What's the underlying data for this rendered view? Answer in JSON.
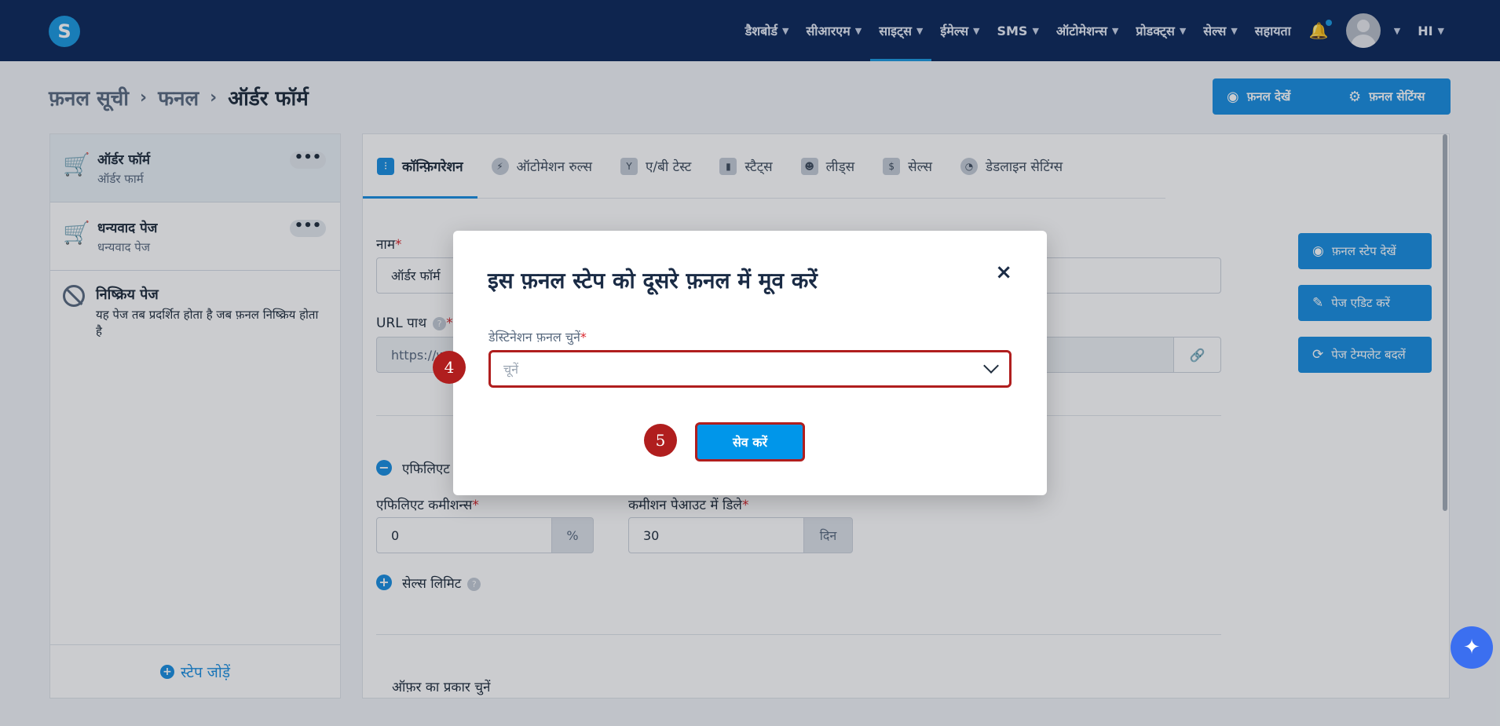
{
  "nav": {
    "logo": "S",
    "items": [
      {
        "label": "डैशबोर्ड"
      },
      {
        "label": "सीआरएम"
      },
      {
        "label": "साइट्स"
      },
      {
        "label": "ईमेल्स"
      },
      {
        "label": "SMS"
      },
      {
        "label": "ऑटोमेशन्स"
      },
      {
        "label": "प्रोडक्ट्स"
      },
      {
        "label": "सेल्स"
      }
    ],
    "active_index": 2,
    "help": "सहायता",
    "lang": "HI"
  },
  "breadcrumb": {
    "items": [
      "फ़नल सूची",
      "फनल",
      "ऑर्डर फॉर्म"
    ]
  },
  "header_buttons": {
    "view_funnel": "फ़नल देखें",
    "funnel_settings": "फ़नल सेटिंग्स"
  },
  "sidebar": {
    "steps": [
      {
        "title": "ऑर्डर फॉर्म",
        "subtitle": "ऑर्डर फार्म"
      },
      {
        "title": "धन्यवाद पेज",
        "subtitle": "धन्यवाद पेज"
      }
    ],
    "more": "•••",
    "inactive": {
      "title": "निष्क्रिय पेज",
      "desc": "यह पेज तब प्रदर्शित होता है जब फ़नल निष्क्रिय होता है"
    },
    "add_step": "स्टेप जोड़ें"
  },
  "tabs": [
    {
      "label": "कॉन्फ़िगरेशन",
      "icon": "sliders-icon",
      "glyph": "⫶"
    },
    {
      "label": "ऑटोमेशन रुल्स",
      "icon": "bolt-icon",
      "glyph": "⚡"
    },
    {
      "label": "ए/बी टेस्ट",
      "icon": "split-icon",
      "glyph": "Y"
    },
    {
      "label": "स्टैट्स",
      "icon": "stats-icon",
      "glyph": "▮"
    },
    {
      "label": "लीड्स",
      "icon": "users-icon",
      "glyph": "☻"
    },
    {
      "label": "सेल्स",
      "icon": "dollar-icon",
      "glyph": "$"
    },
    {
      "label": "डेडलाइन सेटिंग्स",
      "icon": "clock-icon",
      "glyph": "◔"
    }
  ],
  "form": {
    "name_label": "नाम",
    "name_value": "ऑर्डर फॉर्म",
    "url_label": "URL पाथ",
    "url_value": "https://w",
    "affiliate_section": "एफिलिएट",
    "affiliate_commission_label": "एफिलिएट कमीशन्स",
    "affiliate_commission_value": "0",
    "percent": "%",
    "payout_delay_label": "कमीशन पेआउट में डिले",
    "payout_delay_value": "30",
    "days": "दिन",
    "sales_limit": "सेल्स लिमिट",
    "offer_type": "ऑफ़र का प्रकार चुनें",
    "help_mark": "?"
  },
  "side_buttons": {
    "view_step": "फ़नल स्टेप देखें",
    "edit_page": "पेज एडिट करें",
    "change_template": "पेज टेम्पलेट बदलें"
  },
  "modal": {
    "title": "इस फ़नल स्टेप को दूसरे फ़नल में मूव करें",
    "close": "×",
    "dest_label": "डेस्टिनेशन फ़नल चुनें",
    "select_placeholder": "चूनें",
    "save": "सेव करें",
    "required_mark": "*"
  },
  "annotations": {
    "step4": "4",
    "step5": "5"
  },
  "colors": {
    "nav_bg": "#0d2a5c",
    "accent": "#1a8fe0",
    "highlight": "#b01e1e"
  }
}
